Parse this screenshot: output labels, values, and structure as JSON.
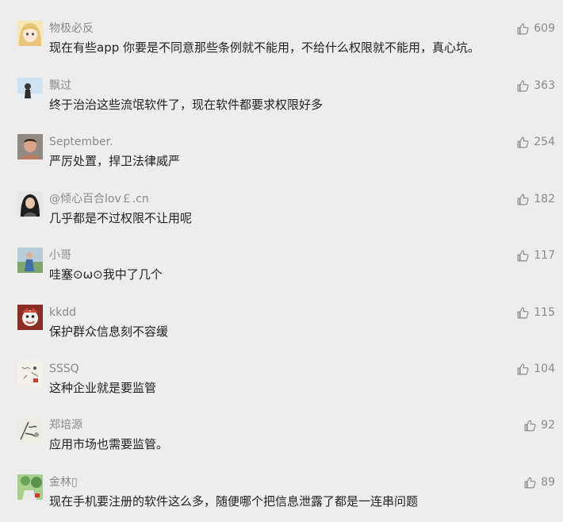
{
  "comments": [
    {
      "author": "物极必反",
      "text": "现在有些app 你要是不同意那些条例就不能用，不给什么权限就不能用，真心坑。",
      "likes": "609",
      "avatar": "anime-girl-avatar",
      "avatar_color": "#e9c77a"
    },
    {
      "author": "飘过",
      "text": "终于治治这些流氓软件了，现在软件都要求权限好多",
      "likes": "363",
      "avatar": "person-sky-avatar",
      "avatar_color": "#9ec7e8"
    },
    {
      "author": "September.",
      "text": "严厉处置，捍卫法律威严",
      "likes": "254",
      "avatar": "man-photo-avatar",
      "avatar_color": "#b77a62"
    },
    {
      "author": "@倾心百合lov￡.cn",
      "text": "几乎都是不过权限不让用呢",
      "likes": "182",
      "avatar": "girl-photo-avatar",
      "avatar_color": "#5a5a5a"
    },
    {
      "author": "小哥",
      "text": "哇塞⊙ω⊙我中了几个",
      "likes": "117",
      "avatar": "outdoor-photo-avatar",
      "avatar_color": "#7fa66b"
    },
    {
      "author": "kkdd",
      "text": "保护群众信息刻不容缓",
      "likes": "115",
      "avatar": "cartoon-avatar",
      "avatar_color": "#c94b3d"
    },
    {
      "author": "SSSQ",
      "text": "这种企业就是要监管",
      "likes": "104",
      "avatar": "sketch-avatar",
      "avatar_color": "#f4f1ea"
    },
    {
      "author": "郑培源",
      "text": "应用市场也需要监管。",
      "likes": "92",
      "avatar": "ink-painting-avatar",
      "avatar_color": "#dcdcd4"
    },
    {
      "author": "金林▯",
      "text": "现在手机要注册的软件这么多，随便哪个把信息泄露了都是一连串问题",
      "likes": "89",
      "avatar": "green-photo-avatar",
      "avatar_color": "#6aa35a"
    }
  ]
}
